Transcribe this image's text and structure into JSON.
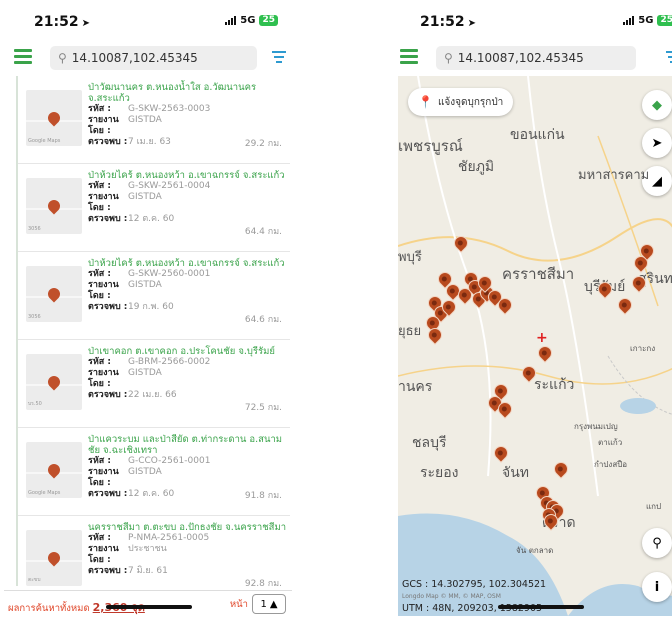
{
  "status": {
    "time": "21:52",
    "network": "5G",
    "battery": "25"
  },
  "search": {
    "value": "14.10087,102.45345"
  },
  "results": [
    {
      "title": "ป่าวัฒนานคร ต.หนองน้ำใส อ.วัฒนานคร จ.สระแก้ว",
      "code": "G-SKW-2563-0003",
      "reporter": "GISTDA",
      "detected": "7 เม.ย. 63",
      "distance": "29.2 กม.",
      "thumb_label": "Google Maps"
    },
    {
      "title": "ป่าห้วยไคร้ ต.หนองหว้า อ.เขาฉกรรจ์ จ.สระแก้ว",
      "code": "G-SKW-2561-0004",
      "reporter": "GISTDA",
      "detected": "12 ต.ค. 60",
      "distance": "64.4 กม.",
      "thumb_label": "3056"
    },
    {
      "title": "ป่าห้วยไคร้ ต.หนองหว้า อ.เขาฉกรรจ์ จ.สระแก้ว",
      "code": "G-SKW-2560-0001",
      "reporter": "GISTDA",
      "detected": "19 ก.พ. 60",
      "distance": "64.6 กม.",
      "thumb_label": "3056"
    },
    {
      "title": "ป่าเขาคอก ต.เขาคอก อ.ประโคนชัย จ.บุรีรัมย์",
      "code": "G-BRM-2566-0002",
      "reporter": "GISTDA",
      "detected": "22 เม.ย. 66",
      "distance": "72.5 กม.",
      "thumb_label": "บร.50"
    },
    {
      "title": "ป่าแควระบม และป่าสียัด ต.ท่ากระดาน อ.สนามชัย จ.ฉะเชิงเทรา",
      "code": "G-CCO-2561-0001",
      "reporter": "GISTDA",
      "detected": "12 ต.ค. 60",
      "distance": "91.8 กม.",
      "thumb_label": "Google Maps"
    },
    {
      "title": "นครราชสีมา ต.ตะขบ อ.ปักธงชัย จ.นครราชสีมา",
      "code": "P-NMA-2561-0005",
      "reporter": "ประชาชน",
      "detected": "7 มิ.ย. 61",
      "distance": "92.8 กม.",
      "thumb_label": "ตะขบ"
    }
  ],
  "labels": {
    "code": "รหัส :",
    "reporter": "รายงานโดย :",
    "detected": "ตรวจพบ :"
  },
  "footer": {
    "total_prefix": "ผลการค้นหาทั้งหมด",
    "total_count": "2,360 จุด",
    "page_label": "หน้า",
    "page_value": "1"
  },
  "map": {
    "report_button": "แจ้งจุดบุกรุกป่า",
    "gcs": "GCS : 14.302795, 102.304521",
    "utm": "UTM : 48N, 209203, 1582905",
    "attribution": "Longdo Map © MM, © MAP, OSM",
    "places": [
      {
        "id": "phetchabun",
        "text": "เพชรบูรณ์"
      },
      {
        "id": "khonkaen",
        "text": "ขอนแก่น"
      },
      {
        "id": "chaiyaphum",
        "text": "ชัยภูมิ"
      },
      {
        "id": "mahasarakham",
        "text": "มหาสารคาม"
      },
      {
        "id": "lopburi",
        "text": "พบุรี"
      },
      {
        "id": "nakhonratchasima",
        "text": "ครราชสีมา"
      },
      {
        "id": "buriram",
        "text": "บุรีรัมย์"
      },
      {
        "id": "surin",
        "text": "สุรินทร์"
      },
      {
        "id": "ayutthaya",
        "text": "ยุธย"
      },
      {
        "id": "nakhon",
        "text": "านคร"
      },
      {
        "id": "sakaeo",
        "text": "ระแก้ว"
      },
      {
        "id": "chonburi",
        "text": "ชลบุรี"
      },
      {
        "id": "rayong",
        "text": "ระยอง"
      },
      {
        "id": "chanthaburi",
        "text": "จันท"
      },
      {
        "id": "trat",
        "text": "ตราด"
      },
      {
        "id": "phnompenh_region",
        "text": "กรุงพนมเปญ"
      },
      {
        "id": "kampong",
        "text": "ตาแก้ว"
      },
      {
        "id": "kampot",
        "text": "กำปงสปือ"
      },
      {
        "id": "koh_kong",
        "text": "เกาะกง"
      },
      {
        "id": "kep",
        "text": "แกป"
      },
      {
        "id": "chanthaburi2",
        "text": "จัน ตกลาด"
      }
    ]
  },
  "icons": {
    "menu": "hamburger-menu-icon",
    "filter": "filter-icon",
    "layers": "layers-icon",
    "locate": "navigation-arrow-icon",
    "measure": "ruler-triangle-icon",
    "pin_user": "user-pin-icon",
    "info": "info-icon"
  },
  "colors": {
    "accent": "#3aa34a",
    "pin": "#b84a1e",
    "total_text": "#e0472a"
  }
}
